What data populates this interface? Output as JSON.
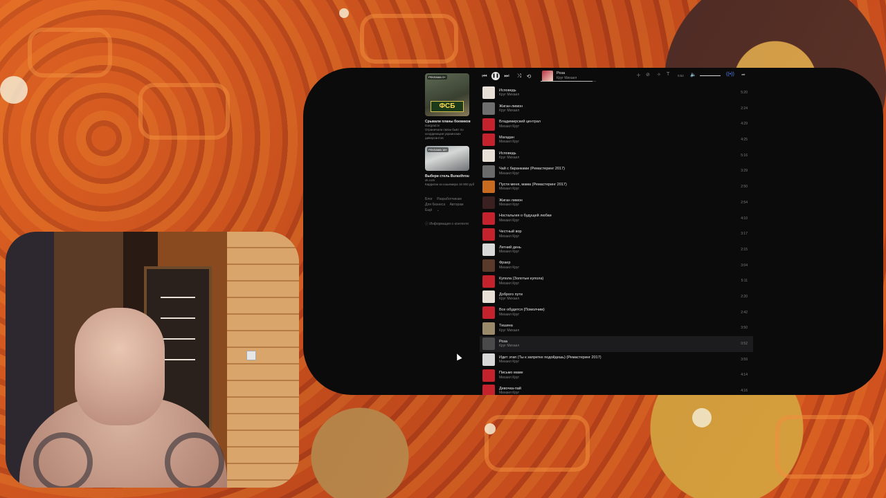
{
  "player": {
    "now_playing": {
      "title": "Роза",
      "artist": "Круг Михаил",
      "elapsed": "0:52"
    }
  },
  "ads": [
    {
      "badge": "РЕКЛАМА 0+",
      "title": "Срывали планы боевиков",
      "source": "tsargrad.tv",
      "description": "Ограничили связи бывт по координации украинских диверсантов",
      "logo_text": "ФСБ"
    },
    {
      "badge": "РЕКЛАМА 18+",
      "title": "Выбери стель Burasthrou",
      "source": "vk.com",
      "description": "Кардиган из кашемира 16 900 руб"
    }
  ],
  "footer_links": [
    "Блог",
    "Разработчикам",
    "Для бизнеса",
    "Авторам",
    "Ещё"
  ],
  "content_info": "Информация о контенте",
  "tracks": [
    {
      "title": "Исповедь",
      "artist": "Круг Михаил",
      "duration": "5:20",
      "color": "#e8e0d6"
    },
    {
      "title": "Жиган-лимон",
      "artist": "Круг Михаил",
      "duration": "2:24",
      "color": "#6e6e6e"
    },
    {
      "title": "Владимирский централ",
      "artist": "Михаил Круг",
      "duration": "4:29",
      "color": "#c4232d"
    },
    {
      "title": "Магадан",
      "artist": "Михаил Круг",
      "duration": "4:25",
      "color": "#c4232d"
    },
    {
      "title": "Исповедь",
      "artist": "Круг Михаил",
      "duration": "5:16",
      "color": "#e8e0d6"
    },
    {
      "title": "Чай с баранками (Ремастеринг 2017)",
      "artist": "Михаил Круг",
      "duration": "3:29",
      "color": "#6a6a6a"
    },
    {
      "title": "Пусти меня, мама (Ремастеринг 2017)",
      "artist": "Михаил Круг",
      "duration": "2:50",
      "color": "#c86a1f"
    },
    {
      "title": "Жиган лимон",
      "artist": "Михаил Круг",
      "duration": "2:54",
      "color": "#3a2020"
    },
    {
      "title": "Ностальгия о будущей любви",
      "artist": "Михаил Круг",
      "duration": "4:10",
      "color": "#c4232d"
    },
    {
      "title": "Честный вор",
      "artist": "Михаил Круг",
      "duration": "3:17",
      "color": "#c4232d"
    },
    {
      "title": "Летний день",
      "artist": "Михаил Круг",
      "duration": "2:15",
      "color": "#d8d8d8"
    },
    {
      "title": "Фраер",
      "artist": "Михаил Круг",
      "duration": "3:04",
      "color": "#5a3a2a"
    },
    {
      "title": "Купола (Золотые купола)",
      "artist": "Михаил Круг",
      "duration": "5:11",
      "color": "#c4232d"
    },
    {
      "title": "Доброго пути",
      "artist": "Круг Михаил",
      "duration": "2:20",
      "color": "#e8e0d6"
    },
    {
      "title": "Все обудется (Помолчим)",
      "artist": "Михаил Круг",
      "duration": "2:42",
      "color": "#c4232d"
    },
    {
      "title": "Тишина",
      "artist": "Круг Михаил",
      "duration": "3:50",
      "color": "#9a8a6a"
    },
    {
      "title": "Роза",
      "artist": "Круг Михаил",
      "duration": "0:52",
      "color": "#4a4a4a",
      "active": true
    },
    {
      "title": "Идет этап (Ты к запретке подойдешь) (Ремастеринг 2017)",
      "artist": "Михаил Круг",
      "duration": "3:59",
      "color": "#d8d8d8"
    },
    {
      "title": "Письмо маме",
      "artist": "Михаил Круг",
      "duration": "4:14",
      "color": "#c4232d"
    },
    {
      "title": "Девочка-пай",
      "artist": "Михаил Круг",
      "duration": "4:16",
      "color": "#c4232d"
    }
  ]
}
